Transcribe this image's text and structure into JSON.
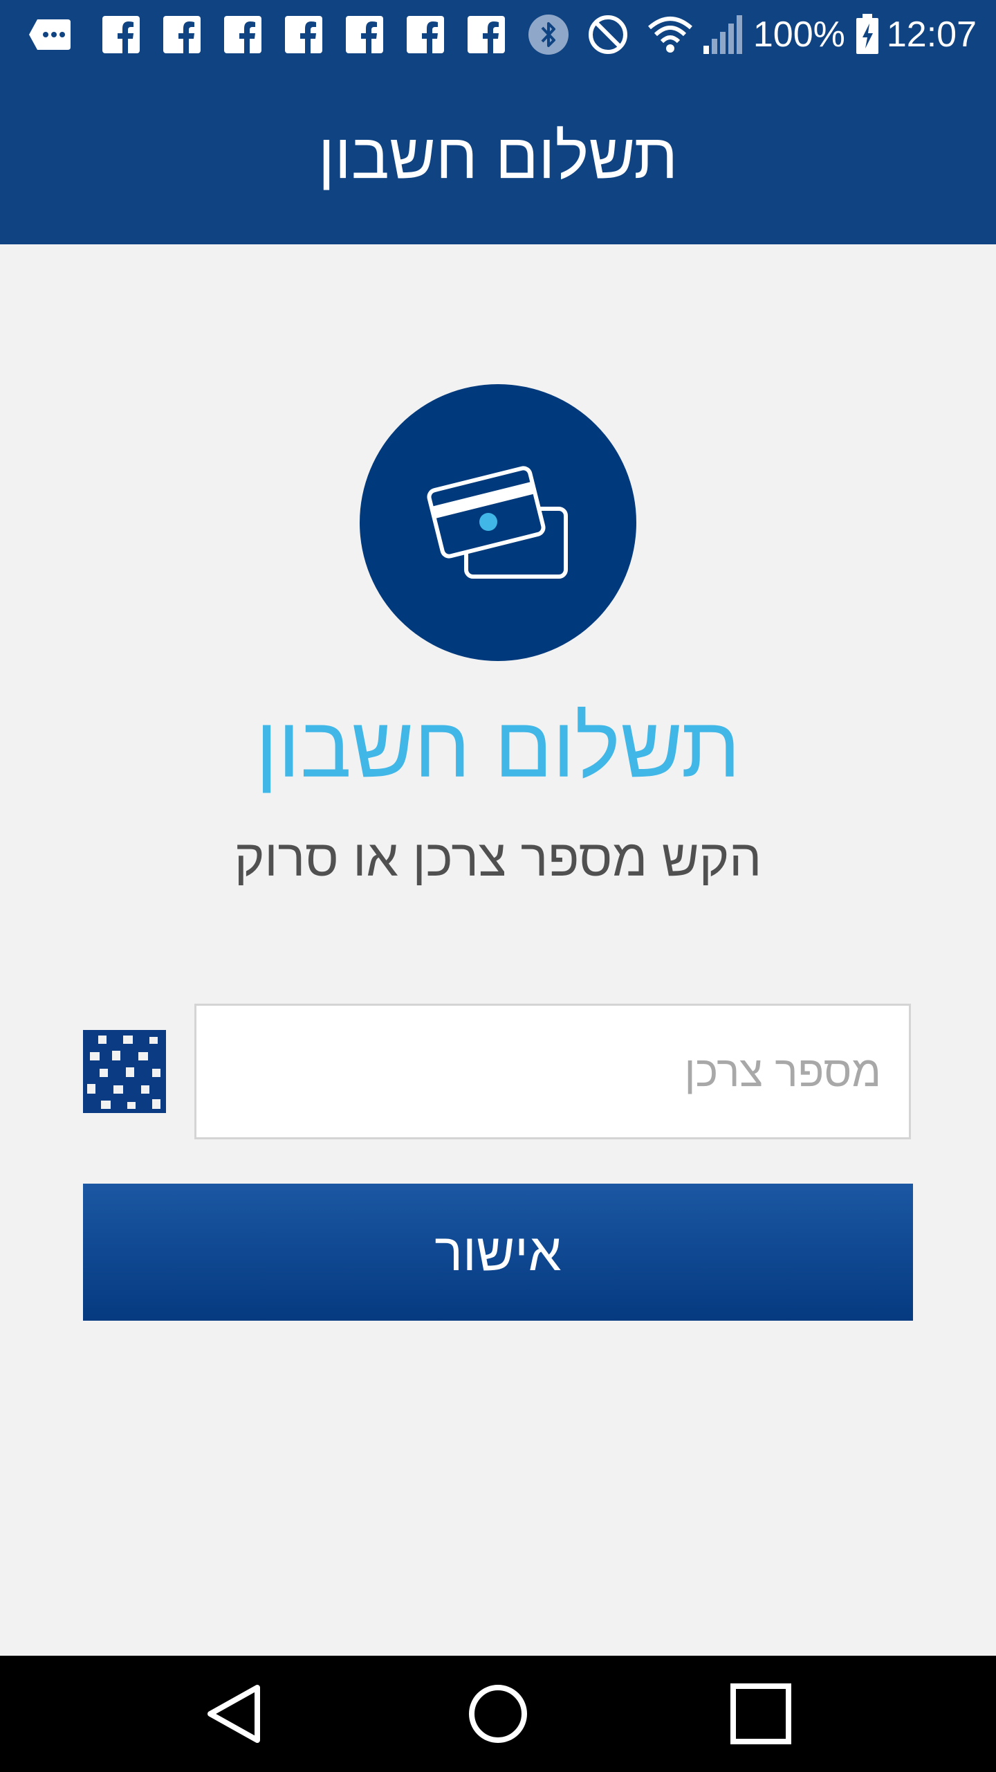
{
  "status_bar": {
    "battery_percent": "100%",
    "time": "12:07",
    "notification_icons": [
      "chat-icon",
      "facebook-icon",
      "facebook-icon",
      "facebook-icon",
      "facebook-icon",
      "facebook-icon",
      "facebook-icon",
      "facebook-icon"
    ],
    "system_icons": [
      "bluetooth-icon",
      "do-not-disturb-icon",
      "wifi-icon",
      "signal-icon",
      "battery-charging-icon"
    ]
  },
  "app_bar": {
    "title": "תשלום חשבון"
  },
  "hero": {
    "icon": "credit-cards-icon",
    "title": "תשלום חשבון",
    "subtitle": "הקש מספר צרכן או סרוק"
  },
  "form": {
    "customer_number_placeholder": "מספר צרכן",
    "customer_number_value": "",
    "scan_icon": "barcode-scan-icon",
    "confirm_label": "אישור"
  },
  "nav_bar": {
    "buttons": [
      "back-icon",
      "home-icon",
      "recent-apps-icon"
    ]
  },
  "colors": {
    "primary": "#104381",
    "circle": "#003a7c",
    "accent": "#40b7e7",
    "background": "#f2f2f3",
    "button_top": "#1b57a3",
    "button_bottom": "#053a80"
  }
}
